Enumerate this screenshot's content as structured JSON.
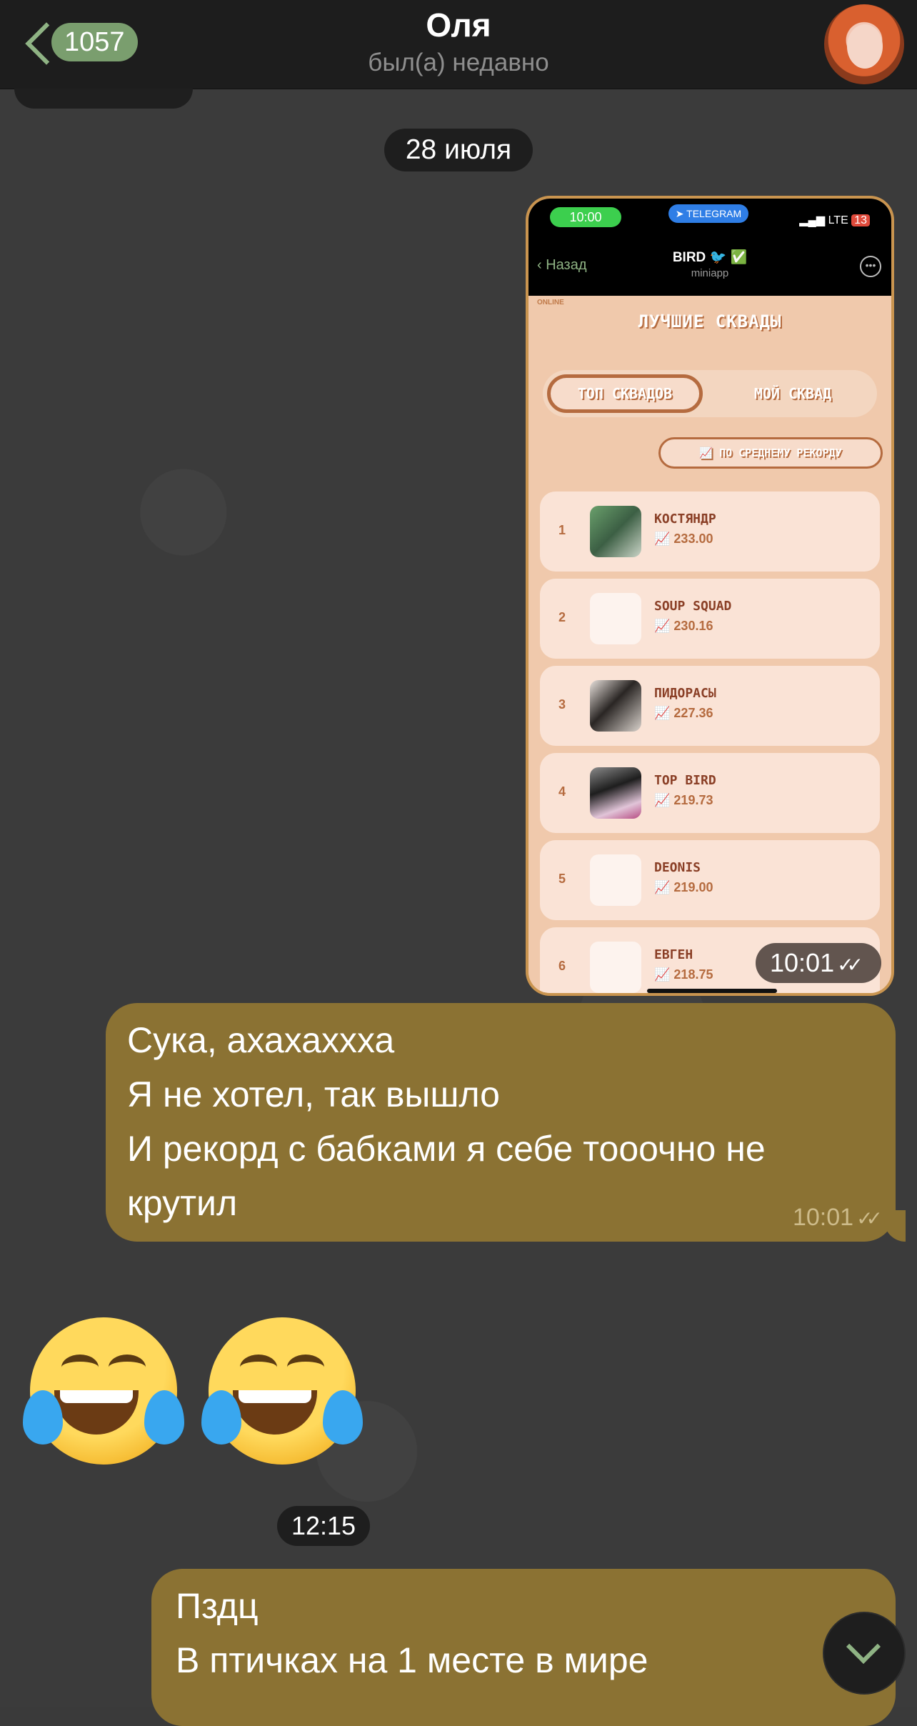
{
  "header": {
    "unread_count": "1057",
    "title": "Оля",
    "status": "был(а) недавно"
  },
  "date_divider": "28 июля",
  "screenshot": {
    "status_time": "10:00",
    "telegram_label": "TELEGRAM",
    "network": "LTE",
    "battery": "13",
    "nav_back": "Назад",
    "nav_title": "BIRD",
    "nav_sub": "miniapp",
    "online": "ONLINE",
    "heading": "ЛУЧШИЕ СКВАДЫ",
    "tab_active": "ТОП СКВАДОВ",
    "tab_other": "МОЙ СКВАД",
    "sort_label": "ПО СРЕДНЕМУ РЕКОРДУ",
    "rows": [
      {
        "rank": "1",
        "name": "КОСТЯНДР",
        "score": "233.00"
      },
      {
        "rank": "2",
        "name": "SOUP SQUAD",
        "score": "230.16"
      },
      {
        "rank": "3",
        "name": "ПИДОРАСЫ",
        "score": "227.36"
      },
      {
        "rank": "4",
        "name": "TOP BIRD",
        "score": "219.73"
      },
      {
        "rank": "5",
        "name": "DEONIS",
        "score": "219.00"
      },
      {
        "rank": "6",
        "name": "ЕВГЕН",
        "score": "218.75"
      }
    ],
    "time": "10:01"
  },
  "message1": {
    "lines": [
      "Сука, ахахаххха",
      "Я не хотел, так вышло",
      "И рекорд с бабками я себе тооочно не",
      "крутил"
    ],
    "time": "10:01"
  },
  "emojis": [
    "😂",
    "😂"
  ],
  "time_divider": "12:15",
  "message2": {
    "lines": [
      "Пздц",
      "В птичках на 1 месте в мире"
    ]
  }
}
